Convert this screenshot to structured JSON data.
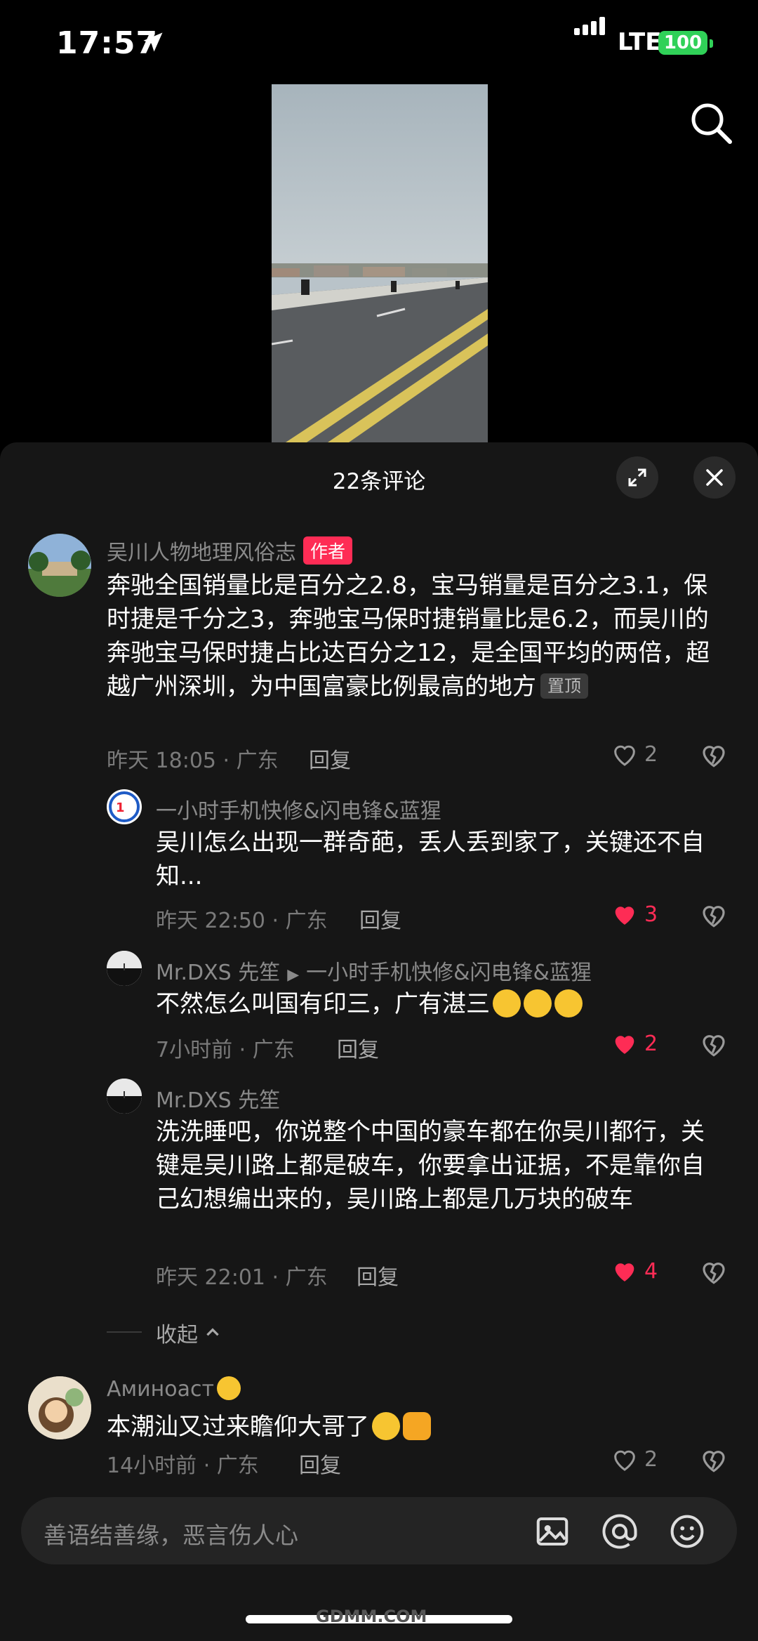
{
  "status_bar": {
    "time": "17:57",
    "network": "LTE",
    "battery": "100"
  },
  "sheet": {
    "title": "22条评论"
  },
  "comments": [
    {
      "user": "吴川人物地理风俗志",
      "author_tag": "作者",
      "text": "奔驰全国销量比是百分之2.8，宝马销量是百分之3.1，保时捷是千分之3，奔驰宝马保时捷销量比是6.2，而吴川的奔驰宝马保时捷占比达百分之12，是全国平均的两倍，超越广州深圳，为中国富豪比例最高的地方",
      "pin_tag": "置顶",
      "meta": "昨天 18:05 · 广东",
      "reply": "回复",
      "likes": "2"
    }
  ],
  "replies": [
    {
      "user": "一小时手机快修&闪电锋&蓝猩",
      "text": "吴川怎么出现一群奇葩，丢人丢到家了，关键还不自知...",
      "meta": "昨天 22:50 · 广东",
      "reply": "回复",
      "likes": "3"
    },
    {
      "user": "Mr.DXS 先笙",
      "reply_to": "一小时手机快修&闪电锋&蓝猩",
      "text": "不然怎么叫国有印三，广有湛三",
      "meta": "7小时前 · 广东",
      "reply": "回复",
      "likes": "2"
    },
    {
      "user": "Mr.DXS 先笙",
      "text": "洗洗睡吧，你说整个中国的豪车都在你吴川都行，关键是吴川路上都是破车，你要拿出证据，不是靠你自己幻想编出来的，吴川路上都是几万块的破车",
      "meta": "昨天 22:01 · 广东",
      "reply": "回复",
      "likes": "4"
    }
  ],
  "collapse_label": "收起",
  "comment2": {
    "user": "Аминоаст",
    "text": "本潮汕又过来瞻仰大哥了",
    "meta": "14小时前 · 广东",
    "reply": "回复",
    "likes": "2"
  },
  "input": {
    "placeholder": "善语结善缘，恶言伤人心"
  },
  "watermark": "GDMM.COM",
  "colors": {
    "like_active": "#fe2c55",
    "author_tag": "#fe2c55",
    "battery": "#30d158"
  }
}
